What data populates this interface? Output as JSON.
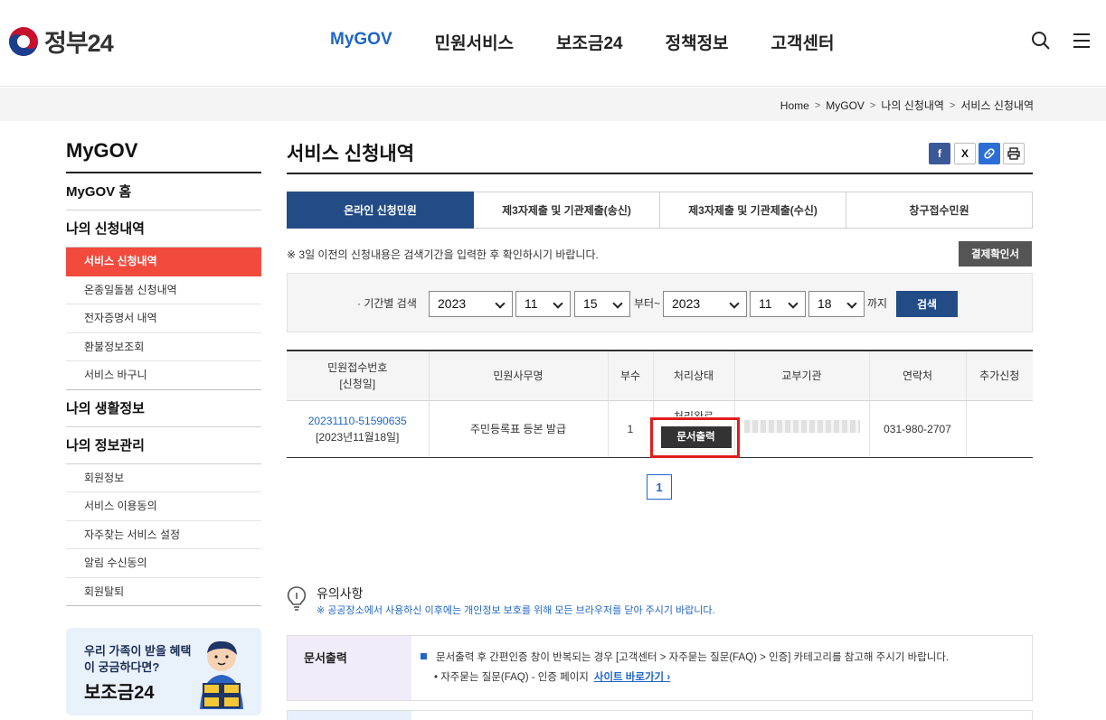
{
  "header": {
    "logo_text": "정부24",
    "nav": [
      "MyGOV",
      "민원서비스",
      "보조금24",
      "정책정보",
      "고객센터"
    ],
    "search_icon": "search-icon",
    "menu_icon": "hamburger-menu-icon"
  },
  "breadcrumb": [
    "Home",
    "MyGOV",
    "나의 신청내역",
    "서비스 신청내역"
  ],
  "sidebar": {
    "title": "MyGOV",
    "home": "MyGOV 홈",
    "group1": {
      "label": "나의 신청내역",
      "items": [
        "서비스 신청내역",
        "온종일돌봄 신청내역",
        "전자증명서 내역",
        "환불정보조회",
        "서비스 바구니"
      ]
    },
    "group2": {
      "label": "나의 생활정보"
    },
    "group3": {
      "label": "나의 정보관리",
      "items": [
        "회원정보",
        "서비스 이용동의",
        "자주찾는 서비스 설정",
        "알림 수신동의",
        "회원탈퇴"
      ]
    },
    "banner": {
      "line1": "우리 가족이 받을 혜택이 궁금하다면?",
      "line2": "보조금24"
    }
  },
  "main": {
    "title": "서비스 신청내역",
    "share": {
      "facebook": "f",
      "x": "X",
      "link": "link-icon",
      "print": "print-icon"
    },
    "tabs": [
      "온라인 신청민원",
      "제3자제출 및 기관제출(송신)",
      "제3자제출 및 기관제출(수신)",
      "창구접수민원"
    ],
    "notice": "※ 3일 이전의 신청내용은 검색기간을 입력한 후 확인하시기 바랍니다.",
    "payment_button": "결제확인서",
    "search": {
      "label": "· 기간별 검색",
      "from": {
        "year": "2023",
        "month": "11",
        "day": "15"
      },
      "from_suffix": "부터~",
      "to": {
        "year": "2023",
        "month": "11",
        "day": "18"
      },
      "to_suffix": "까지",
      "button": "검색"
    },
    "table": {
      "headers": [
        "민원접수번호\n[신청일]",
        "민원사무명",
        "부수",
        "처리상태",
        "교부기관",
        "연락처",
        "추가신청"
      ],
      "rows": [
        {
          "receipt_no": "20231110-51590635",
          "date": "[2023년11월18일]",
          "service": "주민등록표 등본 발급",
          "copies": "1",
          "status": "처리완료",
          "print_button": "문서출력",
          "org": "",
          "phone": "031-980-2707",
          "extra": ""
        }
      ]
    },
    "pagination": [
      "1"
    ],
    "caution": {
      "title": "유의사항",
      "sub": "※ 공공장소에서 사용하신 이후에는 개인정보 보호를 위해 모든 브라우저를 닫아 주시기 바랍니다."
    },
    "guide": {
      "label": "문서출력",
      "line1": "문서출력 후 간편인증 창이 반복되는 경우 [고객센터 > 자주묻는 질문(FAQ) > 인증] 카테고리를 참고해 주시기 바랍니다.",
      "line2": "• 자주묻는 질문(FAQ) - 인증 페이지",
      "link": "사이트 바로가기 ›"
    }
  },
  "colors": {
    "accent_blue": "#1f66c8",
    "navy": "#234c86",
    "active_red": "#f24a3d",
    "highlight_red": "#e01d1d"
  }
}
